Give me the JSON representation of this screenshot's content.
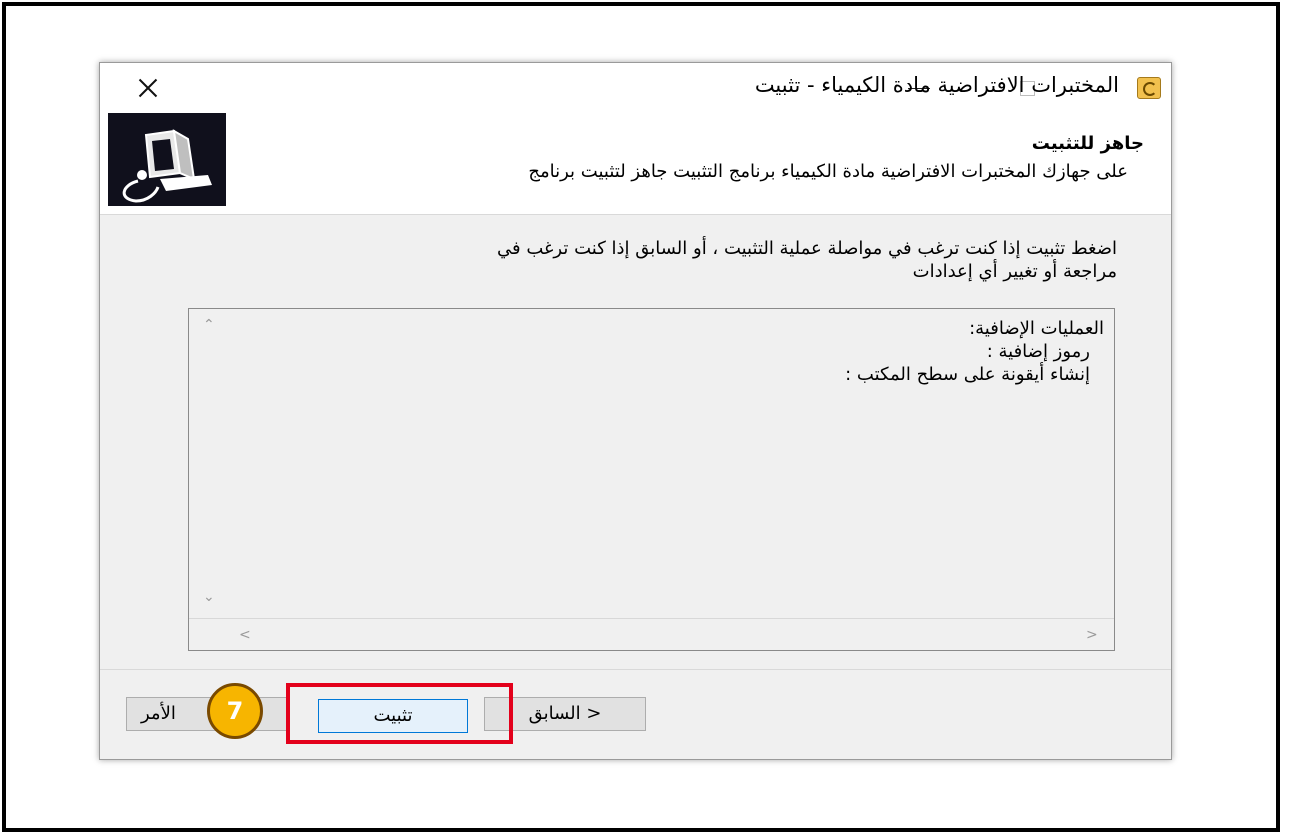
{
  "window": {
    "title": "المختبرات الافتراضية مادة الكيمياء - تثبيت",
    "controls": {
      "minimize": "—",
      "maximize": "□",
      "close": "×"
    }
  },
  "header": {
    "title": "جاهز للتثبيت",
    "subtitle": "على جهازك المختبرات الافتراضية مادة الكيمياء برنامج التثبيت جاهز لتثبيت برنامج"
  },
  "body": {
    "intro_line1": "اضغط تثبيت إذا كنت ترغب في مواصلة عملية التثبيت ، أو السابق إذا كنت ترغب في",
    "intro_line2": "مراجعة أو تغيير أي إعدادات",
    "memo": {
      "line1": "العمليات الإضافية:",
      "line2": "رموز إضافية :",
      "line3": "إنشاء أيقونة على سطح المكتب :"
    },
    "scroll": {
      "up": "⌃",
      "down": "⌄",
      "left": "<",
      "right": ">"
    }
  },
  "footer": {
    "back_label": "< السابق",
    "install_label": "تثبيت",
    "cancel_label": "الأمر"
  },
  "annotation": {
    "step": "7",
    "color": "#e3001b",
    "badge_color": "#f7b500"
  }
}
